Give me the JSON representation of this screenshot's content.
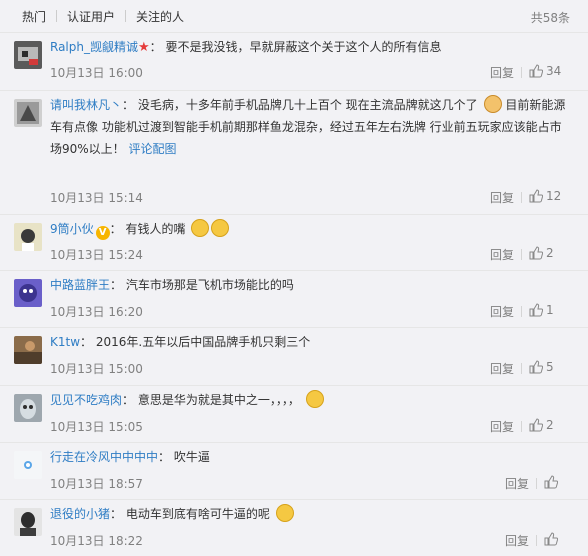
{
  "tabs": [
    "热门",
    "认证用户",
    "关注的人"
  ],
  "total": "共58条",
  "reply_label": "回复",
  "comments": [
    {
      "user": "Ralph_觊觎精诚",
      "text": "要不是我没钱，早就屏蔽这个关于这个人的所有信息",
      "time": "10月13日 16:00",
      "likes": "34"
    },
    {
      "user": "请叫我林凡丶",
      "text_a": "没毛病，十多年前手机品牌几十上百个 现在主流品牌就这几个了",
      "text_b": "目前新能源车有点像",
      "text_c": "功能机过渡到智能手机前期那样鱼龙混杂，经过五年左右洗牌 行业前五玩家应该能占市场90%以上！",
      "link1": "评论配",
      "link2": "图",
      "time": "10月13日 15:14",
      "likes": "12"
    },
    {
      "user": "9筒小伙",
      "text": "有钱人的嘴",
      "time": "10月13日 15:24",
      "likes": "2"
    },
    {
      "user": "中路蓝胖王",
      "text": "汽车市场那是飞机市场能比的吗",
      "time": "10月13日 16:20",
      "likes": "1"
    },
    {
      "user": "K1tw",
      "text": "2016年.五年以后中国品牌手机只剩三个",
      "time": "10月13日 15:00",
      "likes": "5"
    },
    {
      "user": "见见不吃鸡肉",
      "text": "意思是华为就是其中之一，，，，",
      "time": "10月13日 15:05",
      "likes": "2"
    },
    {
      "user": "行走在冷风中中中中",
      "text": "吹牛逼",
      "time": "10月13日 18:57",
      "likes": ""
    },
    {
      "user": "退役的小猪",
      "text": "电动车到底有啥可牛逼的呢",
      "time": "10月13日 18:22",
      "likes": ""
    }
  ]
}
